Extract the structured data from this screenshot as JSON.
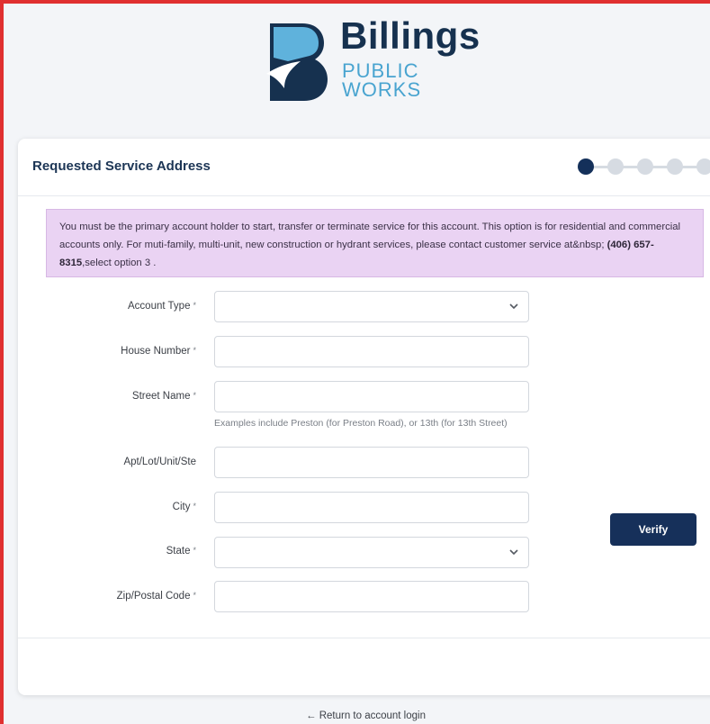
{
  "logo": {
    "line1": "Billings",
    "line2": "PUBLIC",
    "line3": "WORKS"
  },
  "card": {
    "title": "Requested Service Address"
  },
  "notice": {
    "text_before": "You must be the primary account holder to start, transfer or terminate service for this account. This option is for residential and commercial accounts only. For muti-family, multi-unit, new construction or hydrant services, please contact customer service at&nbsp; ",
    "phone": "(406) 657-8315",
    "text_after": ",select option 3 ."
  },
  "form": {
    "required_mark": "*",
    "fields": {
      "account_type": {
        "label": "Account Type",
        "value": ""
      },
      "house_number": {
        "label": "House Number",
        "value": ""
      },
      "street_name": {
        "label": "Street Name",
        "value": "",
        "hint": "Examples include Preston (for Preston Road), or 13th (for 13th Street)"
      },
      "apt": {
        "label": "Apt/Lot/Unit/Ste",
        "value": ""
      },
      "city": {
        "label": "City",
        "value": ""
      },
      "state": {
        "label": "State",
        "value": ""
      },
      "zip": {
        "label": "Zip/Postal Code",
        "value": ""
      }
    }
  },
  "actions": {
    "verify_label": "Verify",
    "return_label": "← Return to account login"
  },
  "stepper": {
    "current": 1,
    "total": 5
  },
  "colors": {
    "primary": "#16305a",
    "accent": "#49a4d0",
    "notice_bg": "#ead3f3",
    "frame": "#e03030"
  }
}
